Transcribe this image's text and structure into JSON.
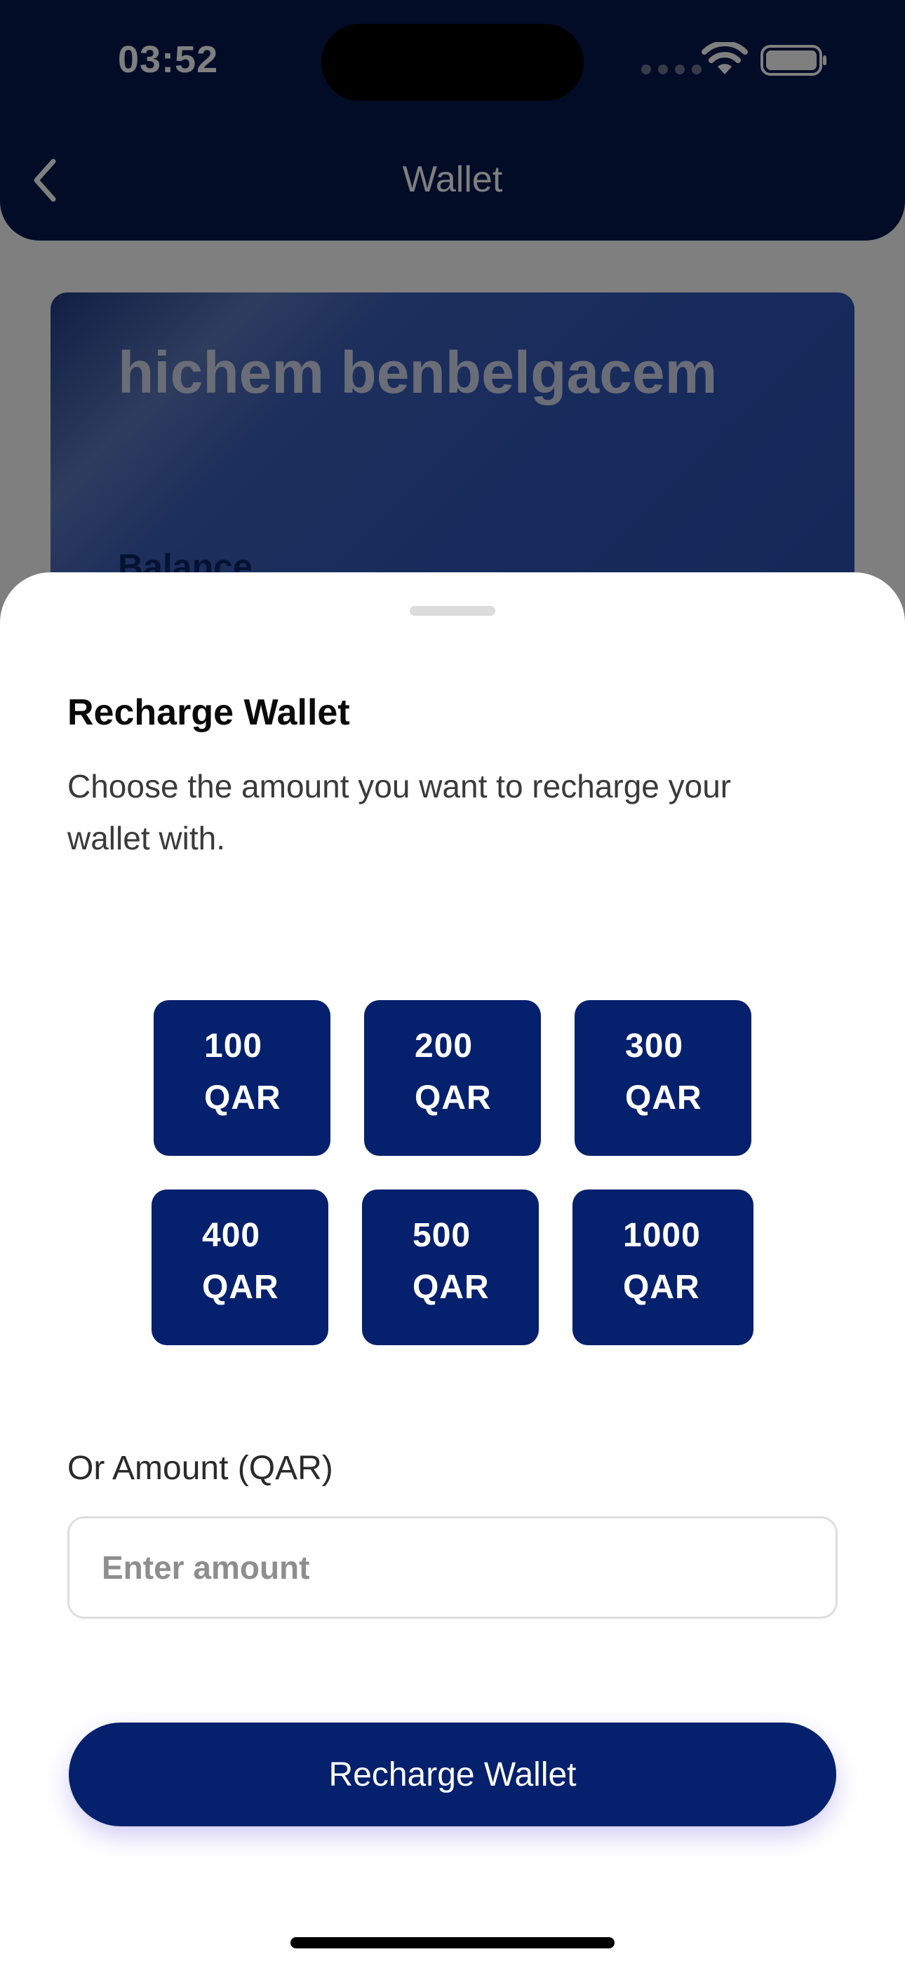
{
  "status_bar": {
    "time": "03:52"
  },
  "header": {
    "title": "Wallet",
    "back_icon": "chevron-left-icon"
  },
  "wallet_card": {
    "holder_name": "hichem benbelgacem",
    "balance_label": "Balance"
  },
  "sheet": {
    "title": "Recharge Wallet",
    "description": "Choose the amount you want to recharge your wallet with.",
    "amount_options": [
      {
        "value": "100",
        "unit": "QAR"
      },
      {
        "value": "200",
        "unit": "QAR"
      },
      {
        "value": "300",
        "unit": "QAR"
      },
      {
        "value": "400",
        "unit": "QAR"
      },
      {
        "value": "500",
        "unit": "QAR"
      },
      {
        "value": "1000",
        "unit": "QAR"
      }
    ],
    "custom_amount_label": "Or Amount (QAR)",
    "custom_amount_placeholder": "Enter amount",
    "custom_amount_value": "",
    "submit_label": "Recharge Wallet"
  },
  "colors": {
    "primary": "#05206d",
    "header": "#05184f",
    "overlay": "rgba(0,0,0,0.5)"
  }
}
